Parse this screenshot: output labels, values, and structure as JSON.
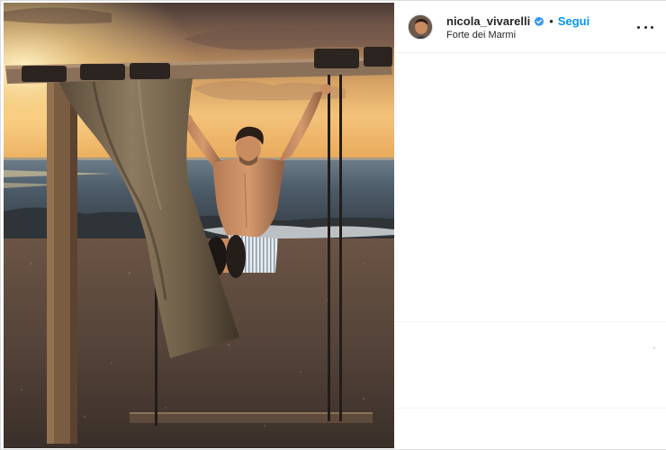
{
  "post": {
    "username": "nicola_vivarelli",
    "verified": true,
    "separator": "•",
    "follow_label": "Segui",
    "location": "Forte dei Marmi",
    "more_icon": "more-horizontal-icon",
    "verified_icon": "verified-badge-icon"
  },
  "colors": {
    "accent": "#0095f6",
    "verified": "#3897f0",
    "text": "#262626",
    "border": "#dbdbdb"
  }
}
